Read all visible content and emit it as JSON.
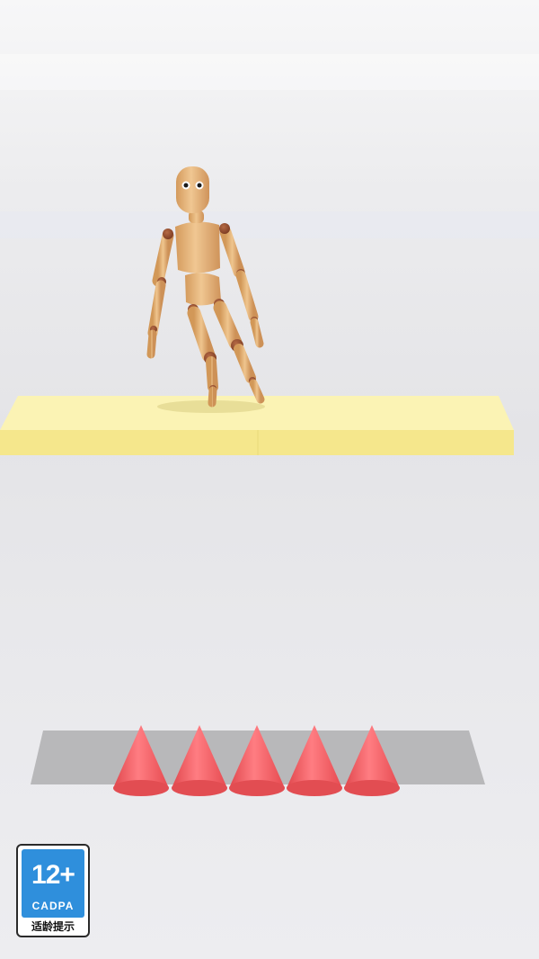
{
  "age_rating": {
    "rating": "12+",
    "organization": "CADPA",
    "caption": "适龄提示"
  },
  "scene": {
    "platform_color": "#f8ec9a",
    "spike_color": "#ef5a5f",
    "spike_count": 5,
    "pit_color": "#b9b9bb",
    "mannequin_color": "#e2b47a"
  }
}
